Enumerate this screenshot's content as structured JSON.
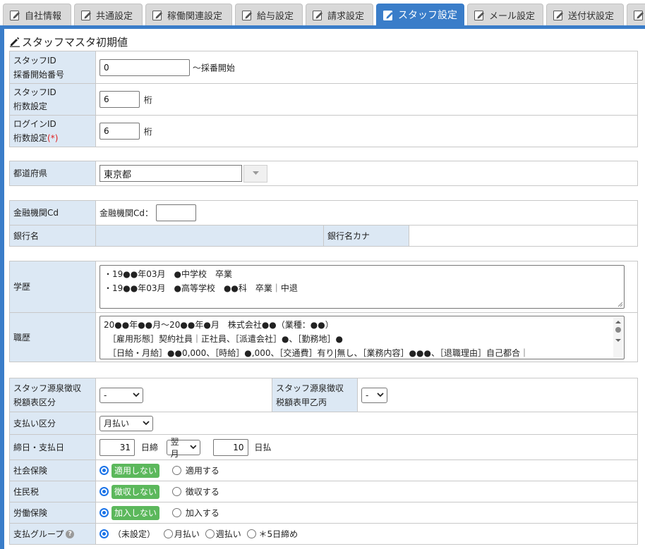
{
  "tabs": [
    {
      "label": "自社情報",
      "active": false
    },
    {
      "label": "共通設定",
      "active": false
    },
    {
      "label": "稼働関連設定",
      "active": false
    },
    {
      "label": "給与設定",
      "active": false
    },
    {
      "label": "請求設定",
      "active": false
    },
    {
      "label": "スタッフ設定",
      "active": true
    },
    {
      "label": "メール設定",
      "active": false
    },
    {
      "label": "送付状設定",
      "active": false
    }
  ],
  "section_title": "スタッフマスタ初期値",
  "staff_id": {
    "label_l1": "スタッフID",
    "label_l2": "採番開始番号",
    "value": "0",
    "suffix": "～採番開始"
  },
  "staff_digits": {
    "label_l1": "スタッフID",
    "label_l2": "桁数設定",
    "value": "6",
    "unit": "桁"
  },
  "login_digits": {
    "label_l1": "ログインID",
    "label_l2": "桁数設定",
    "required_mark": "(*)",
    "value": "6",
    "unit": "桁"
  },
  "prefecture": {
    "label": "都道府県",
    "value": "東京都"
  },
  "bank": {
    "code_label": "金融機関Cd",
    "code_inline_label": "金融機関Cd：",
    "code_value": "",
    "name_label": "銀行名",
    "kana_label": "銀行名カナ"
  },
  "education": {
    "label": "学歴",
    "lines": [
      "・19●●年03月　●中学校　卒業",
      "・19●●年03月　●高等学校　●●科　卒業｜中退"
    ]
  },
  "career": {
    "label": "職歴",
    "lines": [
      "20●●年●●月～20●●年●月　株式会社●●（業種：●●）",
      "　［雇用形態］契約社員｜正社員、［派遣会社］●、［勤務地］●",
      "　［日給・月給］●●0,000、［時給］●,000、［交通費］有り|無し、［業務内容］●●●、［退職理由］自己都合｜"
    ]
  },
  "tax_table": {
    "label_l1": "スタッフ源泉徴収",
    "label_l2": "税額表区分",
    "value": "-",
    "label2_l1": "スタッフ源泉徴収",
    "label2_l2": "税額表甲乙丙",
    "value2": "-"
  },
  "payment_type": {
    "label": "支払い区分",
    "value": "月払い"
  },
  "closing": {
    "label": "締日・支払日",
    "close_day": "31",
    "close_unit": "日締",
    "month": "翌月",
    "pay_day": "10",
    "pay_unit": "日払"
  },
  "social_insurance": {
    "label": "社会保険",
    "opt1": "適用しない",
    "opt2": "適用する"
  },
  "resident_tax": {
    "label": "住民税",
    "opt1": "徴収しない",
    "opt2": "徴収する"
  },
  "labor_insurance": {
    "label": "労働保険",
    "opt1": "加入しない",
    "opt2": "加入する"
  },
  "pay_group": {
    "label": "支払グループ",
    "opt1": "（未設定）",
    "opt2": "月払い",
    "opt3": "週払い",
    "opt4": "＊5日締め"
  },
  "colors": {
    "accent": "#3a7dc9",
    "label_bg": "#dce8f4",
    "badge_green": "#5cb85c",
    "required": "#e02020"
  }
}
